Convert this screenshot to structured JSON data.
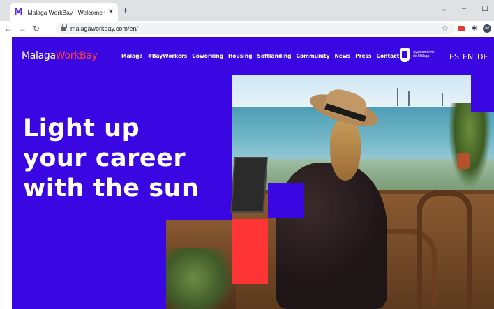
{
  "browser": {
    "tab_title": "Malaga WorkBay - Welcome to M",
    "tab_favicon": "M",
    "url": "malagaworkbay.com/en/",
    "profile_initial": "M"
  },
  "site": {
    "logo_main": "Malaga",
    "logo_accent": "WorkBay",
    "nav": [
      "Malaga",
      "#BayWorkers",
      "Coworking",
      "Housing",
      "Softlanding",
      "Community",
      "News",
      "Press",
      "Contact"
    ],
    "city_hall": [
      "Ayuntamiento",
      "de Málaga"
    ],
    "languages": [
      "ES",
      "EN",
      "DE"
    ],
    "headline": [
      "Light up",
      "your career",
      "with the sun"
    ]
  },
  "colors": {
    "brand_blue": "#3a06e1",
    "brand_red": "#ff3434",
    "white": "#ffffff"
  }
}
